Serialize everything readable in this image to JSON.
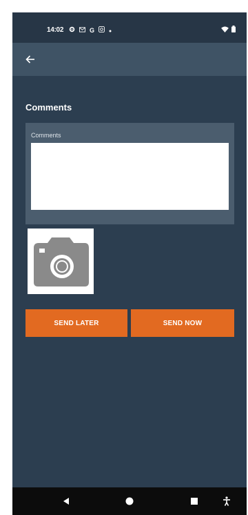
{
  "status_bar": {
    "time": "14:02",
    "icons": [
      "settings-icon",
      "mail-icon",
      "google-icon",
      "camera-roll-icon",
      "dot-icon",
      "wifi-icon",
      "battery-icon"
    ],
    "google_letter": "G"
  },
  "app_bar": {
    "back_icon": "arrow-left-icon"
  },
  "comments": {
    "section_title": "Comments",
    "field_label": "Comments",
    "value": ""
  },
  "photo": {
    "icon": "camera-icon"
  },
  "actions": {
    "send_later_label": "SEND LATER",
    "send_now_label": "SEND NOW"
  },
  "nav_bar": {
    "icons": [
      "back-triangle-icon",
      "home-circle-icon",
      "recents-square-icon",
      "accessibility-icon"
    ]
  },
  "colors": {
    "background": "#2c3e50",
    "app_bar": "#3f5365",
    "card": "#4b5d6e",
    "accent": "#e26a21"
  }
}
